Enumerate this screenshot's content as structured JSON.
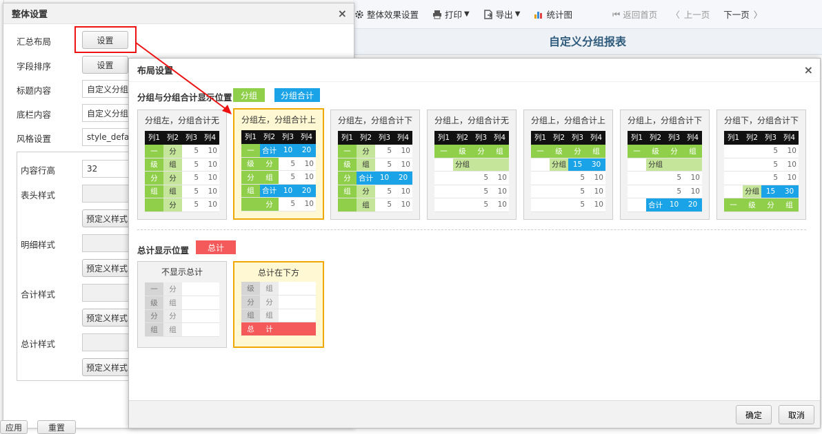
{
  "toolbar": {
    "overall_effect": "整体效果设置",
    "print": "打印",
    "export": "导出",
    "chart": "统计图",
    "home": "返回首页",
    "prev": "上一页",
    "next": "下一页"
  },
  "report": {
    "title": "自定义分组报表"
  },
  "overall": {
    "title": "整体设置",
    "rows": {
      "summary_layout": "汇总布局",
      "field_sort": "字段排序",
      "title_content": "标题内容",
      "footer_content": "底栏内容",
      "style_setting": "风格设置",
      "row_height": "内容行高",
      "header_style": "表头样式",
      "detail_style": "明细样式",
      "subtotal_style": "合计样式",
      "total_style": "总计样式"
    },
    "set_label": "设置",
    "title_value": "自定义分组报",
    "footer_value": "自定义分组报",
    "style_value": "style_default",
    "row_height_value": "32",
    "preset_label": "预定义样式",
    "apply_label": "应用",
    "reset_label": "重置"
  },
  "layout": {
    "title": "布局设置",
    "group_section": "分组与分组合计显示位置",
    "tag_group": "分组",
    "tag_subtotal": "分组合计",
    "total_section": "总计显示位置",
    "tag_total": "总计",
    "cols": [
      "列1",
      "列2",
      "列3",
      "列4"
    ],
    "cards": [
      "分组左，分组合计无",
      "分组左，分组合计上",
      "分组左，分组合计下",
      "分组上，分组合计无",
      "分组上，分组合计上",
      "分组上，分组合计下",
      "分组下，分组合计下"
    ],
    "total_cards": [
      "不显示总计",
      "总计在下方"
    ],
    "cell": {
      "v5": "5",
      "v10": "10",
      "v15": "15",
      "v20": "20",
      "v30": "30",
      "fen": "分",
      "zu": "组",
      "yi": "一",
      "ji": "级",
      "heji": "合计",
      "fenzu": "分组",
      "zong": "总",
      "jisum": "计"
    },
    "ok": "确定",
    "cancel": "取消"
  },
  "colors": {
    "group": "#8fcf4a",
    "subtotal": "#1aa3e6",
    "total": "#f55a5a",
    "selected": "#f0a800",
    "arrow": "#e11111"
  }
}
